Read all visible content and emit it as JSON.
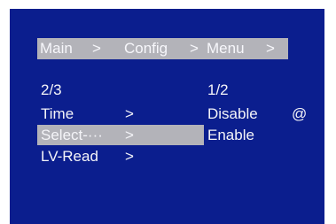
{
  "breadcrumb": {
    "main": "Main",
    "sep1": ">",
    "config": "Config",
    "sep2": ">",
    "menu": "Menu",
    "sep3": ">"
  },
  "left_menu": {
    "page": "2/3",
    "items": [
      {
        "label": "Time",
        "arrow": ">"
      },
      {
        "label": "Select-···",
        "arrow": ">"
      },
      {
        "label": "LV-Read",
        "arrow": ">"
      }
    ],
    "selected_index": 1
  },
  "right_menu": {
    "page": "1/2",
    "items": [
      {
        "label": "Disable",
        "marker": "@"
      },
      {
        "label": "Enable",
        "marker": ""
      }
    ],
    "current_index": 0
  },
  "colors": {
    "background": "#0b1e8e",
    "highlight": "#b3b3b9",
    "text": "#f4f4f8"
  }
}
